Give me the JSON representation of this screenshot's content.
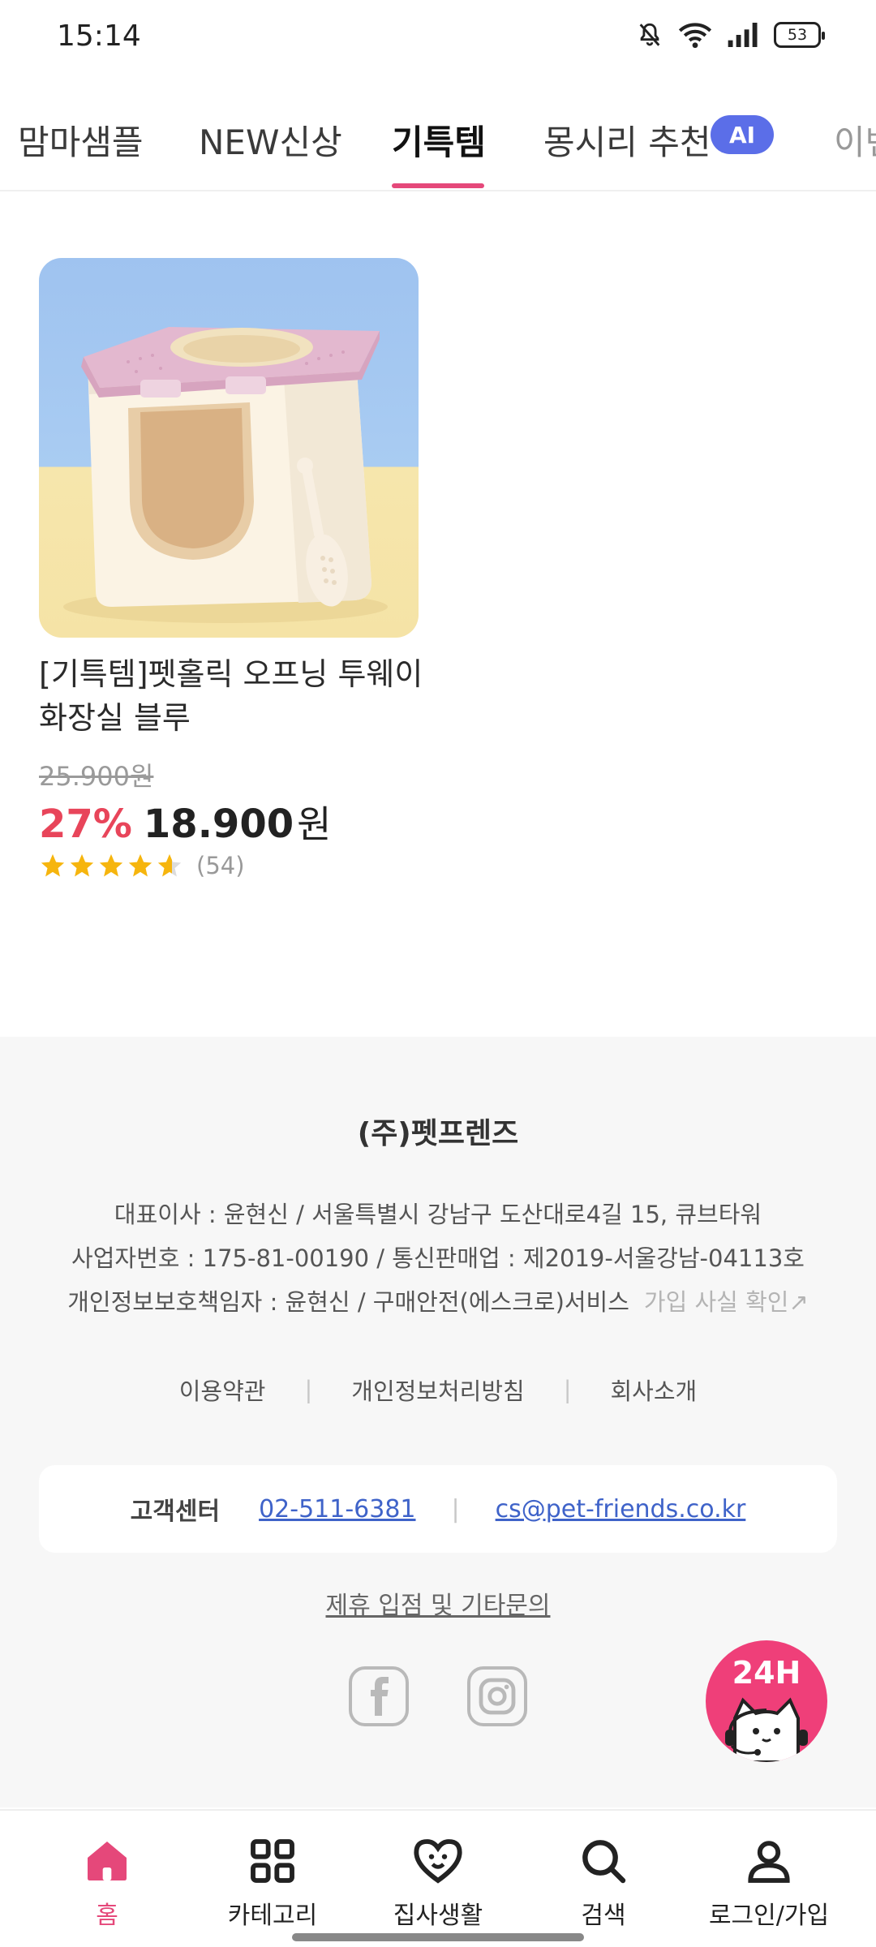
{
  "status_bar": {
    "time": "15:14",
    "battery": "53"
  },
  "tabs": {
    "items": [
      {
        "label": "맘마샘플"
      },
      {
        "label": "NEW신상"
      },
      {
        "label": "기특템"
      },
      {
        "label": "몽시리 추천"
      },
      {
        "label": "이벤"
      }
    ],
    "active_index": 2,
    "ai_badge": "AI"
  },
  "product": {
    "name": "[기특템]펫홀릭 오프닝 투웨이 화장실 블루",
    "original_price": "25.900원",
    "discount": "27%",
    "price": "18.900",
    "price_unit": "원",
    "rating": 4.5,
    "review_count": "(54)"
  },
  "footer": {
    "company": "(주)펫프렌즈",
    "line1": "대표이사 : 윤현신 / 서울특별시 강남구 도산대로4길 15, 큐브타워",
    "line2": "사업자번호 : 175-81-00190 / 통신판매업 : 제2019-서울강남-04113호",
    "line3": "개인정보보호책임자 : 윤현신 / 구매안전(에스크로)서비스",
    "line3_link": "가입 사실 확인↗",
    "links": [
      "이용약관",
      "개인정보처리방침",
      "회사소개"
    ],
    "cs_label": "고객센터",
    "cs_phone": "02-511-6381",
    "cs_email": "cs@pet-friends.co.kr",
    "partner_link": "제휴 입점 및 기타문의"
  },
  "chat_fab": {
    "label": "24H"
  },
  "bottom_nav": {
    "items": [
      {
        "label": "홈",
        "icon": "home-icon"
      },
      {
        "label": "카테고리",
        "icon": "grid-icon"
      },
      {
        "label": "집사생활",
        "icon": "pet-heart-icon"
      },
      {
        "label": "검색",
        "icon": "search-icon"
      },
      {
        "label": "로그인/가입",
        "icon": "user-icon"
      }
    ],
    "active_index": 0
  },
  "colors": {
    "accent": "#e5487a",
    "discount": "#e8455a",
    "link": "#3f63c9",
    "ai_badge": "#5b6ee8",
    "star": "#f6b50e"
  }
}
